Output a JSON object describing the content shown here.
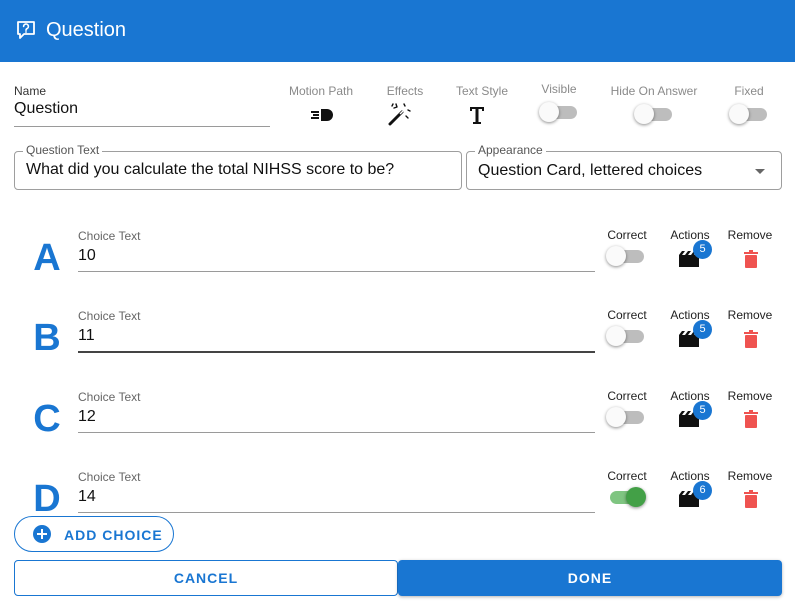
{
  "dialog": {
    "title": "Question",
    "icon": "question-bubble-icon",
    "accent_color": "#1976d2"
  },
  "name_field": {
    "label": "Name",
    "value": "Question"
  },
  "toolbar": {
    "motion_path": "Motion Path",
    "effects": "Effects",
    "text_style": "Text Style",
    "visible": "Visible",
    "hide_on_answer": "Hide On Answer",
    "fixed": "Fixed",
    "visible_on": false,
    "hide_on_answer_on": false,
    "fixed_on": false
  },
  "question_text": {
    "label": "Question Text",
    "value": "What did you calculate the total NIHSS score to be?"
  },
  "appearance": {
    "label": "Appearance",
    "value": "Question Card, lettered choices"
  },
  "columns": {
    "correct": "Correct",
    "actions": "Actions",
    "remove": "Remove"
  },
  "choices": [
    {
      "letter": "A",
      "label": "Choice Text",
      "value": "10",
      "correct": false,
      "actions_count": "5"
    },
    {
      "letter": "B",
      "label": "Choice Text",
      "value": "11",
      "correct": false,
      "actions_count": "5"
    },
    {
      "letter": "C",
      "label": "Choice Text",
      "value": "12",
      "correct": false,
      "actions_count": "5"
    },
    {
      "letter": "D",
      "label": "Choice Text",
      "value": "14",
      "correct": true,
      "actions_count": "6"
    }
  ],
  "buttons": {
    "add_choice": "ADD CHOICE",
    "cancel": "CANCEL",
    "done": "DONE"
  }
}
